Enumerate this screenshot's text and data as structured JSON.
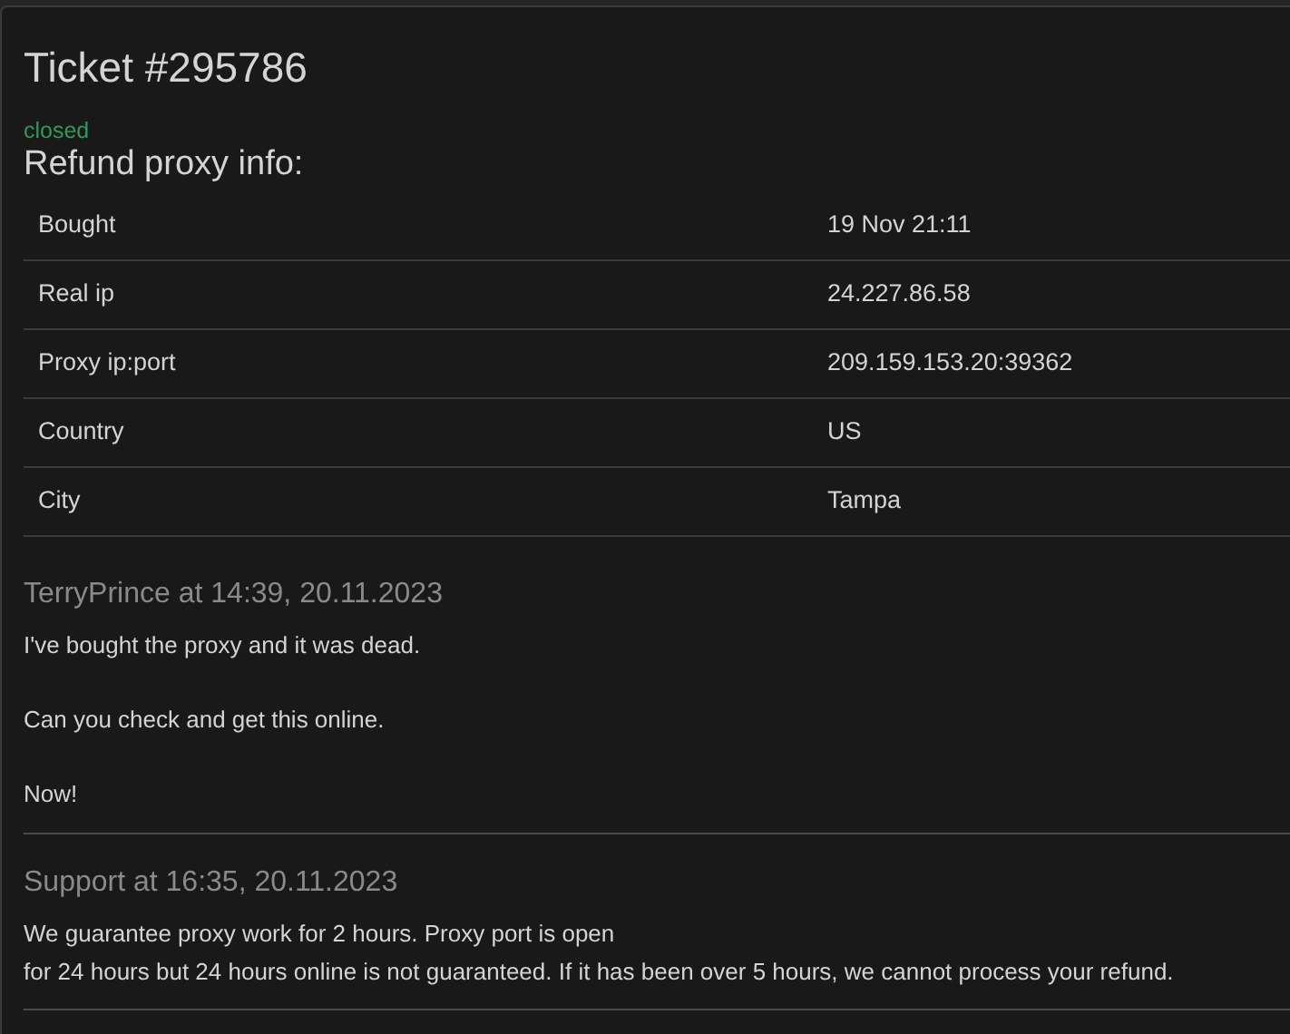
{
  "ticket": {
    "title": "Ticket #295786",
    "status": "closed"
  },
  "info": {
    "heading": "Refund proxy info:",
    "rows": [
      {
        "label": "Bought",
        "value": "19 Nov 21:11"
      },
      {
        "label": "Real ip",
        "value": "24.227.86.58"
      },
      {
        "label": "Proxy ip:port",
        "value": "209.159.153.20:39362"
      },
      {
        "label": "Country",
        "value": "US"
      },
      {
        "label": "City",
        "value": "Tampa"
      }
    ]
  },
  "messages": [
    {
      "header": "TerryPrince at 14:39, 20.11.2023",
      "paragraphs": [
        [
          "I've bought the proxy and it was dead."
        ],
        [
          "Can you check and get this online."
        ],
        [
          "Now!"
        ]
      ]
    },
    {
      "header": "Support at 16:35, 20.11.2023",
      "paragraphs": [
        [
          "We guarantee proxy work for 2 hours. Proxy port is open",
          "for 24 hours but 24 hours online is not guaranteed. If it has been over 5 hours, we cannot process your refund."
        ]
      ]
    }
  ]
}
